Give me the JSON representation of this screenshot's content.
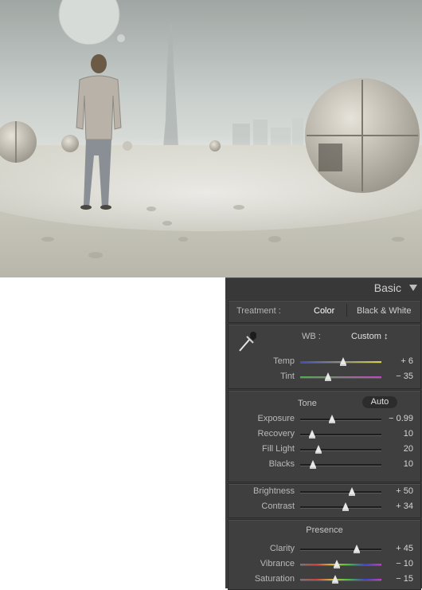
{
  "panel": {
    "title": "Basic",
    "treatment": {
      "label": "Treatment :",
      "color": "Color",
      "bw": "Black & White"
    },
    "wb": {
      "label": "WB :",
      "value": "Custom ↕"
    },
    "tone": {
      "label": "Tone",
      "auto": "Auto"
    },
    "presence": {
      "label": "Presence"
    },
    "sliders": {
      "temp": {
        "label": "Temp",
        "value": "+ 6",
        "pos": 0.53
      },
      "tint": {
        "label": "Tint",
        "value": "− 35",
        "pos": 0.34
      },
      "exposure": {
        "label": "Exposure",
        "value": "− 0.99",
        "pos": 0.39
      },
      "recovery": {
        "label": "Recovery",
        "value": "10",
        "pos": 0.15
      },
      "filllight": {
        "label": "Fill Light",
        "value": "20",
        "pos": 0.23
      },
      "blacks": {
        "label": "Blacks",
        "value": "10",
        "pos": 0.16
      },
      "brightness": {
        "label": "Brightness",
        "value": "+ 50",
        "pos": 0.64
      },
      "contrast": {
        "label": "Contrast",
        "value": "+ 34",
        "pos": 0.56
      },
      "clarity": {
        "label": "Clarity",
        "value": "+ 45",
        "pos": 0.7
      },
      "vibrance": {
        "label": "Vibrance",
        "value": "− 10",
        "pos": 0.45
      },
      "saturation": {
        "label": "Saturation",
        "value": "− 15",
        "pos": 0.43
      }
    }
  },
  "icons": {
    "dropper": "eyedropper-icon",
    "toggle": "triangle-down-icon"
  }
}
